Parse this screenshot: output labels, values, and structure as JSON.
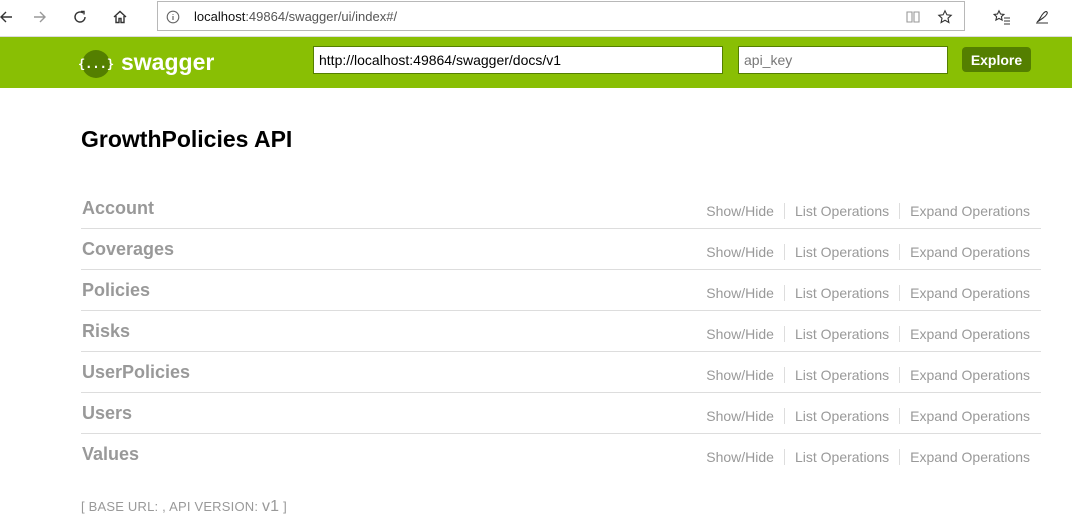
{
  "browser": {
    "url_host": "localhost",
    "url_rest": ":49864/swagger/ui/index#/"
  },
  "header": {
    "logo_symbol": "{...}",
    "logo_text": "swagger",
    "url_value": "http://localhost:49864/swagger/docs/v1",
    "api_key_placeholder": "api_key",
    "explore_label": "Explore",
    "brand_color": "#89bf04",
    "brand_dark": "#547f00"
  },
  "api": {
    "title": "GrowthPolicies API",
    "resources": [
      {
        "name": "Account"
      },
      {
        "name": "Coverages"
      },
      {
        "name": "Policies"
      },
      {
        "name": "Risks"
      },
      {
        "name": "UserPolicies"
      },
      {
        "name": "Users"
      },
      {
        "name": "Values"
      }
    ],
    "ops": {
      "show_hide": "Show/Hide",
      "list": "List Operations",
      "expand": "Expand Operations"
    }
  },
  "footer": {
    "open": "[",
    "base_url": "BASE URL: ",
    "sep": ", ",
    "api_version": "API VERSION: ",
    "version": "v1",
    "close": "]"
  }
}
